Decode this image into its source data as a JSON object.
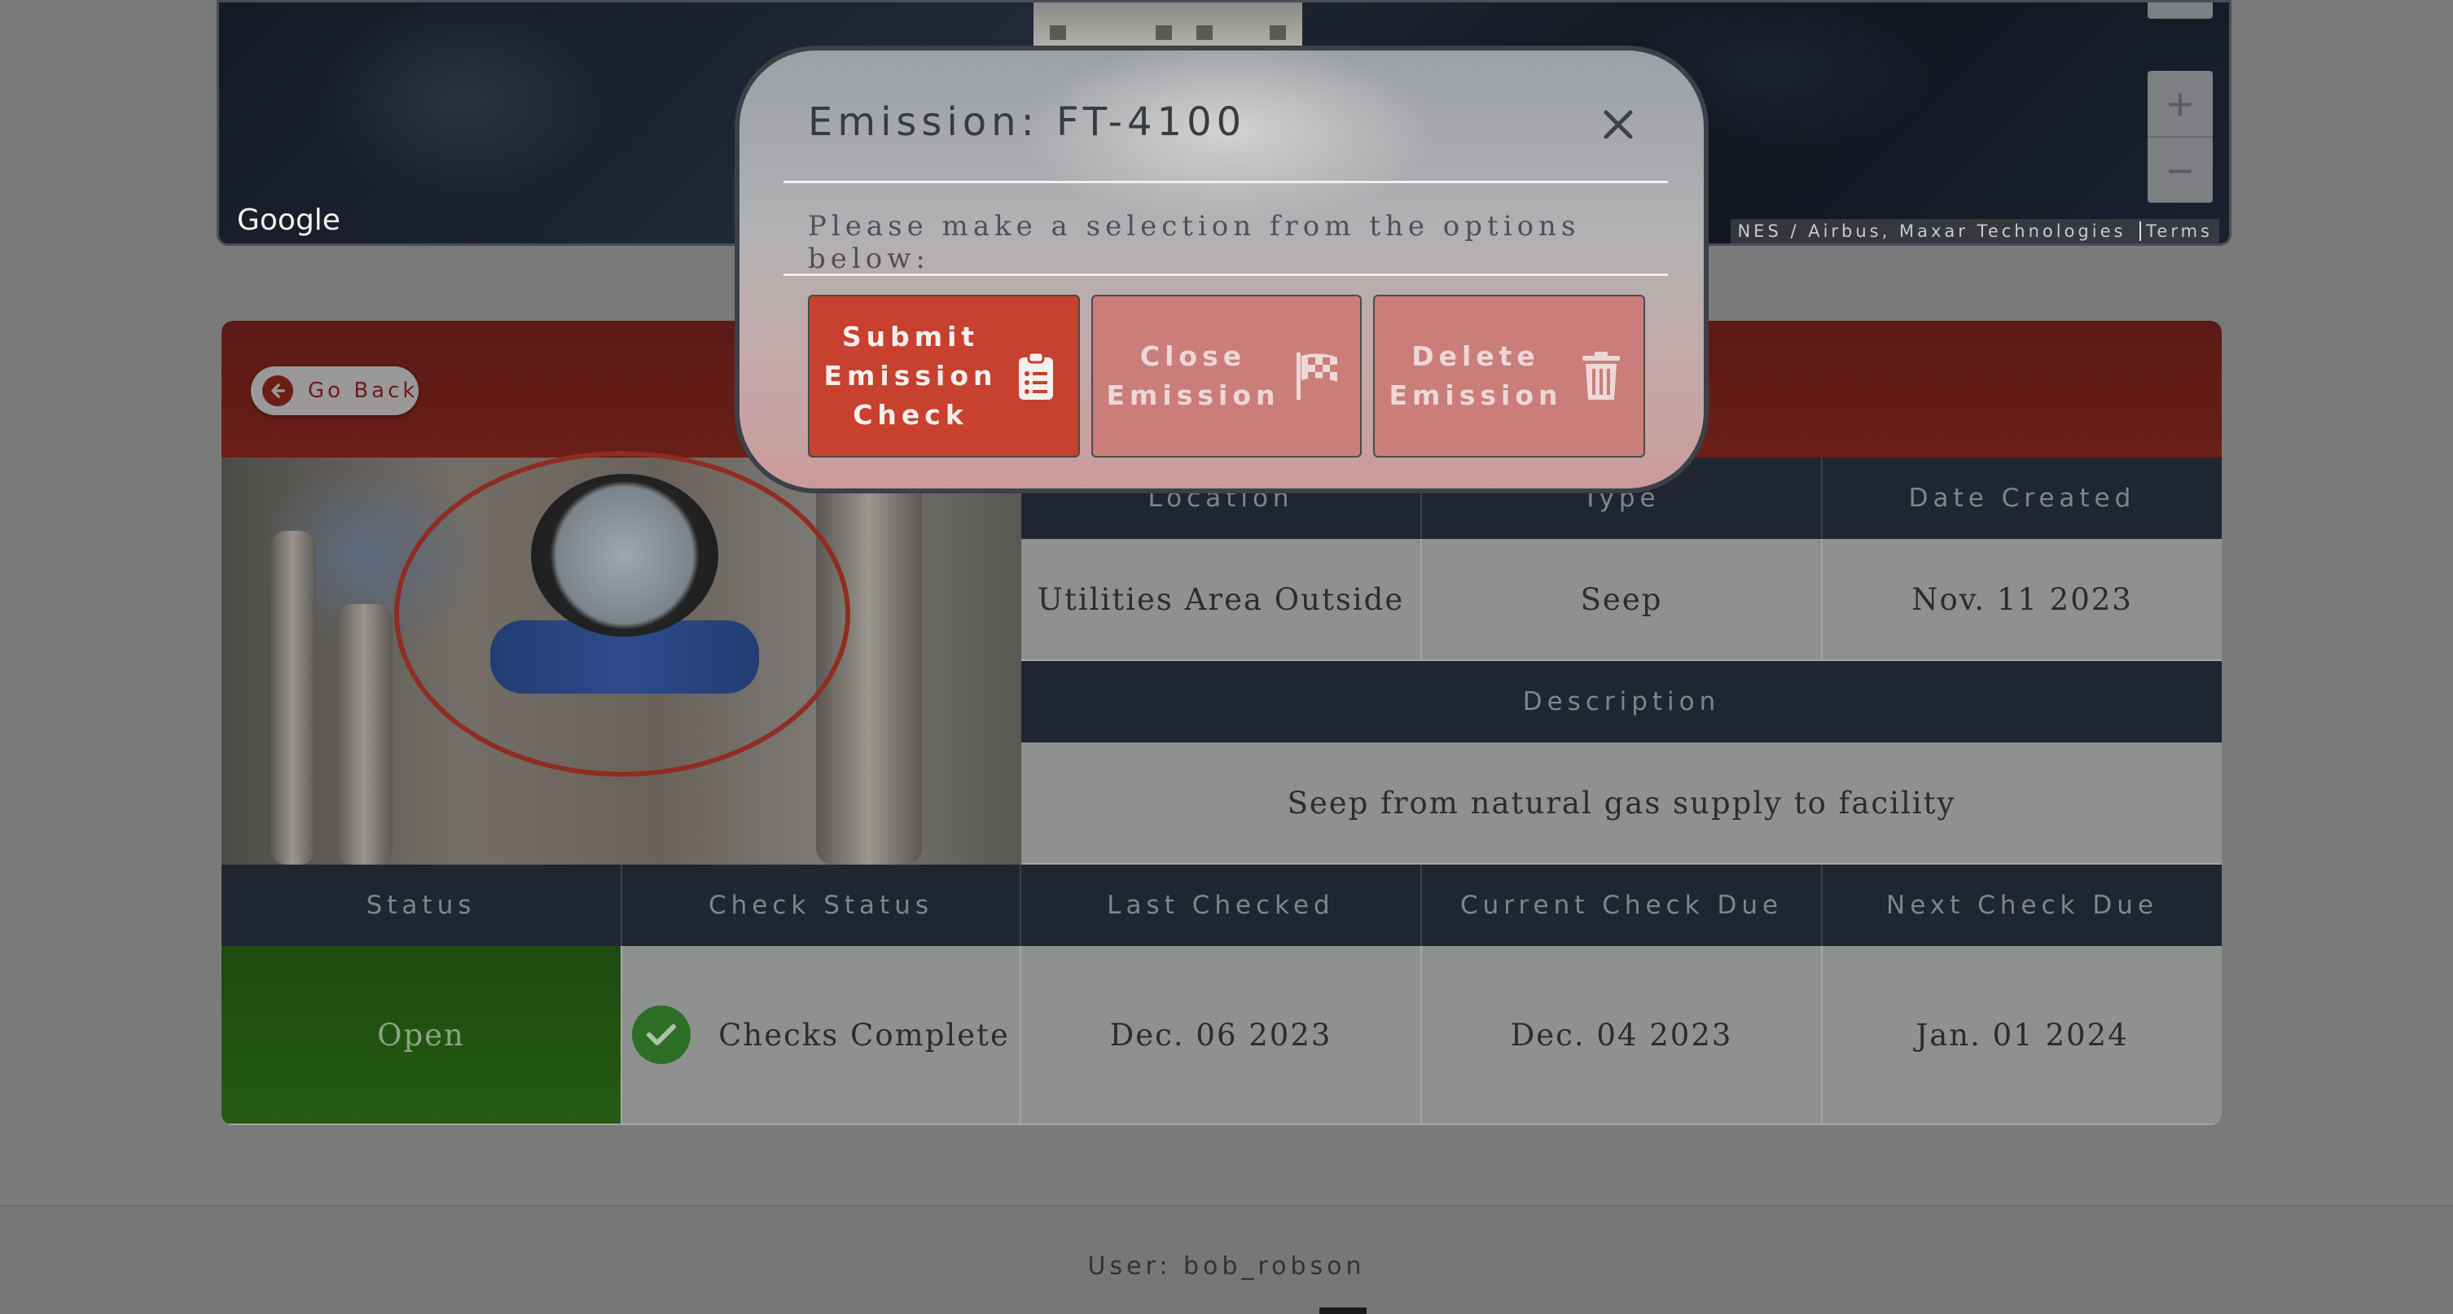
{
  "map": {
    "google_label": "Google",
    "attribution": "NES / Airbus, Maxar Technologies",
    "terms_label": "Terms",
    "zoom_in": "+",
    "zoom_out": "−"
  },
  "card": {
    "go_back_label": "Go Back",
    "headers_top": [
      "Location",
      "Type",
      "Date Created"
    ],
    "values_top": [
      "Utilities Area Outside",
      "Seep",
      "Nov. 11 2023"
    ],
    "description_header": "Description",
    "description": "Seep from natural gas supply to facility",
    "headers_bottom": [
      "Status",
      "Check Status",
      "Last Checked",
      "Current Check Due",
      "Next Check Due"
    ],
    "status": "Open",
    "check_status": "Checks Complete",
    "last_checked": "Dec. 06 2023",
    "current_check_due": "Dec. 04 2023",
    "next_check_due": "Jan. 01 2024"
  },
  "modal": {
    "title": "Emission: FT-4100",
    "prompt": "Please make a selection from the options below:",
    "buttons": [
      {
        "label_lines": [
          "Submit",
          "Emission",
          "Check"
        ],
        "icon": "clipboard-list-icon"
      },
      {
        "label_lines": [
          "Close",
          "Emission"
        ],
        "icon": "checkered-flag-icon"
      },
      {
        "label_lines": [
          "Delete",
          "Emission"
        ],
        "icon": "trash-icon"
      }
    ]
  },
  "footer": {
    "user_label": "User: bob_robson"
  },
  "colors": {
    "primary_red": "#c8402e",
    "header_dark": "#1f2631",
    "status_green": "#245c12"
  }
}
